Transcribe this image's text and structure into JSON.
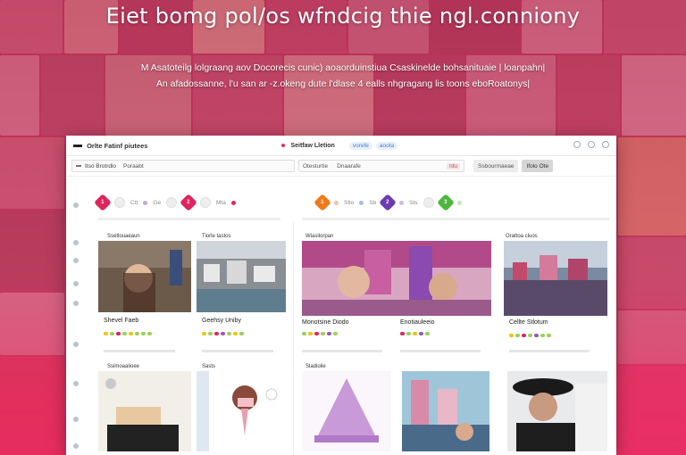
{
  "headline": "Eiet bomg pol/os wfndcig thie ngl.conniony",
  "subline_1": "M Asatoteilg lolgraang aov Docorecis cunic) aoaorduinstiua  Csaskinelde bohsanituaie | loanpahn|",
  "subline_2": "An afadossanne, l'u san ar  -z.okeng dute l'dlase  4  ealls nhgragang lis toons eboRoatonys|",
  "topbar": {
    "logo": "Orlte Fatinf piutees",
    "nav_link": "Seitfaw Lletion",
    "pill_1": "vorefe",
    "pill_2": "aoota"
  },
  "filterbar": {
    "search_label": "Itso Brotrdlo",
    "search_value": "Poraabt",
    "filter_label": "Otesturtie",
    "filter_value": "Dnaarafe",
    "chip": "ntu",
    "btn_1": "Ssbourmaeae",
    "btn_2": "Ifolo Ote"
  },
  "categories_left": [
    {
      "color": "#e0245e",
      "label": ""
    },
    {
      "label": "Ctt"
    },
    {
      "label": "Ge"
    },
    {
      "color": "#e0245e",
      "label": ""
    },
    {
      "label": "Mta"
    }
  ],
  "categories_right": [
    {
      "color": "#f07a1a",
      "label": ""
    },
    {
      "label": "Stlo"
    },
    {
      "label": "Sb"
    },
    {
      "color": "#6c3bb0",
      "label": ""
    },
    {
      "label": "Sts"
    },
    {
      "color": "#4cb83c",
      "label": ""
    }
  ],
  "cards": [
    {
      "tag": "Ssetlouaeaun",
      "title": "Shevel Faeb"
    },
    {
      "tag": "Tiorle tastos",
      "title": "Geehsy Uniby"
    },
    {
      "tag": "Wiasilorpan",
      "title": "Monotsine Diodo"
    },
    {
      "tag": "",
      "title": "Enotiauleeio"
    },
    {
      "tag": "Orattoa cluos",
      "title": "Cellte Stlotum"
    },
    {
      "tag": "Ssimoaalioee",
      "title": ""
    },
    {
      "tag": "Sasts",
      "title": ""
    },
    {
      "tag": "Sladiolie",
      "title": ""
    }
  ],
  "colors": {
    "accent": "#e0245e",
    "brand_bg": "#c23a5e"
  }
}
